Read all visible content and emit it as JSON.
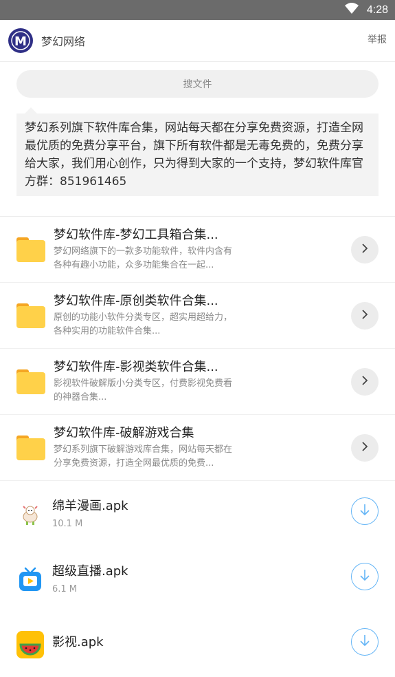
{
  "status": {
    "time": "4:28",
    "wifi_icon": "wifi-icon"
  },
  "header": {
    "title": "梦幻网络",
    "report": "举报",
    "logo_icon": "m-logo-icon",
    "logo_letter": "M"
  },
  "search": {
    "label": "搜文件"
  },
  "description": "梦幻系列旗下软件库合集，网站每天都在分享免费资源，打造全网最优质的免费分享平台，旗下所有软件都是无毒免费的，免费分享给大家，我们用心创作，只为得到大家的一个支持，梦幻软件库官方群：851961465",
  "folders": [
    {
      "title": "梦幻软件库-梦幻工具箱合集...",
      "desc_line1": "梦幻网络旗下的一款多功能软件，软件内含有",
      "desc_line2": "各种有趣小功能，众多功能集合在一起..."
    },
    {
      "title": "梦幻软件库-原创类软件合集...",
      "desc_line1": "原创的功能小软件分类专区，超实用超给力，",
      "desc_line2": "各种实用的功能软件合集..."
    },
    {
      "title": "梦幻软件库-影视类软件合集...",
      "desc_line1": "影视软件破解版小分类专区，付费影视免费看",
      "desc_line2": "的神器合集..."
    },
    {
      "title": "梦幻软件库-破解游戏合集",
      "desc_line1": "梦幻系列旗下破解游戏库合集，网站每天都在",
      "desc_line2": "分享免费资源，打造全网最优质的免费..."
    }
  ],
  "files": [
    {
      "name": "绵羊漫画.apk",
      "size": "10.1 M",
      "icon": "sheep-icon"
    },
    {
      "name": "超级直播.apk",
      "size": "6.1 M",
      "icon": "tv-icon"
    },
    {
      "name": "影视.apk",
      "size": "",
      "icon": "watermelon-icon"
    }
  ],
  "colors": {
    "status_bar": "#6b6b6b",
    "accent_blue": "#64b5f6",
    "folder_yellow": "#ffd149",
    "logo_navy": "#2f2f86"
  }
}
